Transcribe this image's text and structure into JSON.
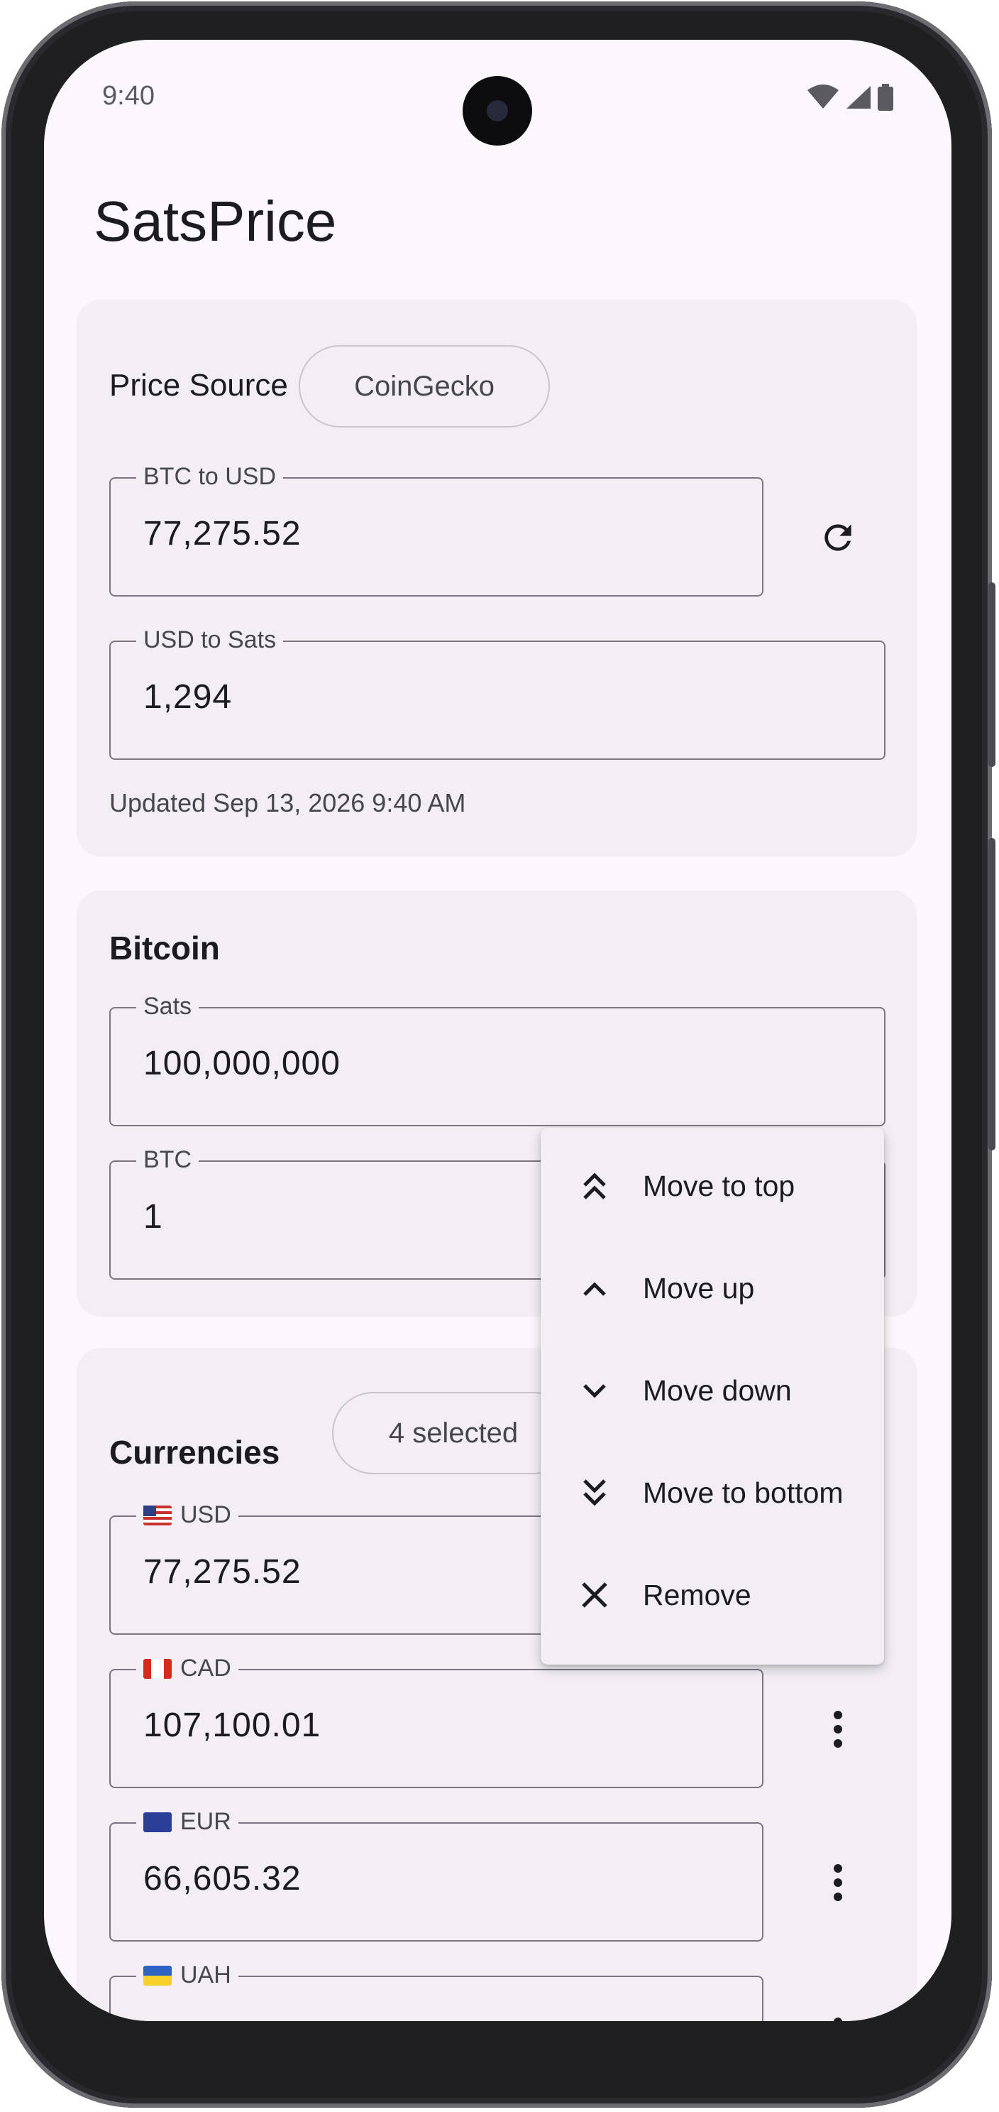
{
  "status_bar": {
    "time": "9:40"
  },
  "app": {
    "title": "SatsPrice"
  },
  "price_card": {
    "source_label": "Price Source",
    "source_chip": "CoinGecko",
    "btc_to_usd_label": "BTC to USD",
    "btc_to_usd_value": "77,275.52",
    "usd_to_sats_label": "USD to Sats",
    "usd_to_sats_value": "1,294",
    "updated": "Updated Sep 13, 2026 9:40 AM"
  },
  "bitcoin_card": {
    "title": "Bitcoin",
    "sats_label": "Sats",
    "sats_value": "100,000,000",
    "btc_label": "BTC",
    "btc_value": "1"
  },
  "currencies_card": {
    "title": "Currencies",
    "selected_chip": "4 selected",
    "items": [
      {
        "code": "USD",
        "value": "77,275.52"
      },
      {
        "code": "CAD",
        "value": "107,100.01"
      },
      {
        "code": "EUR",
        "value": "66,605.32"
      },
      {
        "code": "UAH",
        "value": ""
      }
    ]
  },
  "context_menu": {
    "items": [
      {
        "label": "Move to top",
        "icon": "double-chevron-up-icon"
      },
      {
        "label": "Move up",
        "icon": "chevron-up-icon"
      },
      {
        "label": "Move down",
        "icon": "chevron-down-icon"
      },
      {
        "label": "Move to bottom",
        "icon": "double-chevron-down-icon"
      },
      {
        "label": "Remove",
        "icon": "close-icon"
      }
    ]
  },
  "colors": {
    "background": "#fbf7fc",
    "card": "#f2eef4",
    "outline": "#7a7580",
    "text": "#1c1b1f"
  }
}
